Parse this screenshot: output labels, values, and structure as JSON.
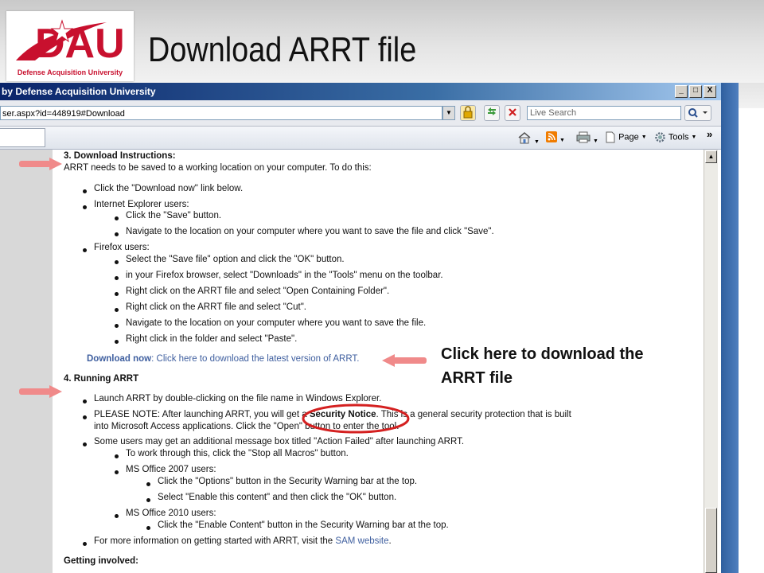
{
  "slide": {
    "title": "Download ARRT file",
    "logo_text": "DAU",
    "logo_tagline": "Defense Acquisition University"
  },
  "browser": {
    "window_title": "by Defense Acquisition University",
    "window_controls": [
      "_",
      "□",
      "X"
    ],
    "address": "ser.aspx?id=448919#Download",
    "search_placeholder": "Live Search",
    "commands": {
      "page": "Page",
      "tools": "Tools",
      "chevron": "»"
    },
    "icons": [
      "home-icon",
      "rss-feed-icon",
      "print-icon",
      "page-icon",
      "gear-icon",
      "lock-icon",
      "refresh-icon",
      "stop-icon",
      "search-icon"
    ]
  },
  "content": {
    "s3_heading": "3.  Download Instructions:",
    "s3_intro": "ARRT needs to be saved to a working location on your computer.  To do this:",
    "s3_b1": "Click the \"Download now\" link below.",
    "s3_b2": "Internet Explorer users:",
    "s3_b2_1": "Click the \"Save\" button.",
    "s3_b2_2": "Navigate to the location on your computer where you want to save the file and click \"Save\".",
    "s3_b3": "Firefox users:",
    "s3_b3_1": "Select the \"Save file\" option and click the \"OK\" button.",
    "s3_b3_2": "in your Firefox browser, select \"Downloads\" in the \"Tools\" menu on the toolbar.",
    "s3_b3_3": "Right click on the ARRT file and select \"Open Containing Folder\".",
    "s3_b3_4": "Right click on the ARRT file and select \"Cut\".",
    "s3_b3_5": "Navigate to the location on your computer where you want to save the file.",
    "s3_b3_6": "Right click in the folder and select \"Paste\".",
    "download_label": "Download now",
    "download_sep": ":  ",
    "download_link": "Click here to download the latest version of ARRT",
    "download_end": ".",
    "s4_heading": "4.  Running ARRT",
    "s4_b1": "Launch ARRT by double-clicking on the file name in Windows Explorer.",
    "s4_b2_pre": "PLEASE NOTE:  After launching ARRT, you will get a ",
    "s4_b2_bold": "Security Notice",
    "s4_b2_post": ".  This is a general security protection that is built",
    "s4_b2_line2": "into Microsoft Access applications.  Click the \"Open\" button to enter the tool.",
    "s4_b3": "Some users may get an additional message box titled \"Action Failed\" after launching ARRT.",
    "s4_b3_1": "To work through this, click the \"Stop all Macros\" button.",
    "s4_b3_2": "MS Office 2007 users:",
    "s4_b3_2_1": "Click the \"Options\" button in the Security Warning bar at the top.",
    "s4_b3_2_2": "Select \"Enable this content\" and then click the \"OK\" button.",
    "s4_b3_3": "MS Office 2010 users:",
    "s4_b3_3_1": "Click the \"Enable Content\" button in the Security Warning bar at the top.",
    "s4_b4_pre": "For more information on getting started with ARRT, visit the ",
    "s4_b4_link": "SAM website",
    "s4_b4_end": ".",
    "getting_involved": "Getting involved:"
  },
  "annotation": {
    "callout_line1": "Click here to download the",
    "callout_line2": "ARRT file"
  },
  "colors": {
    "title_bar": "#0a246a",
    "link": "#3f5f9f",
    "arrow": "#f08a8a",
    "ellipse": "#d42020",
    "logo_red": "#c8102e"
  }
}
